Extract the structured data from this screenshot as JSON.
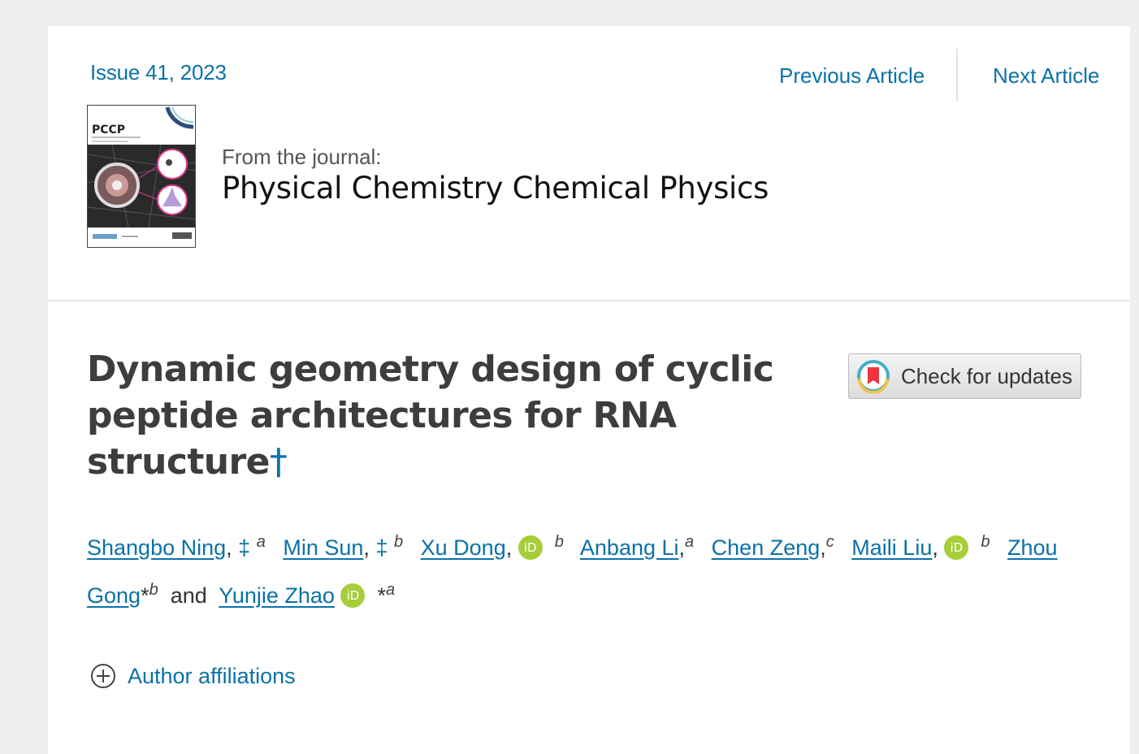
{
  "issue": "Issue 41, 2023",
  "nav": {
    "previous": "Previous Article",
    "next": "Next Article"
  },
  "journal": {
    "from_label": "From the journal:",
    "name": "Physical Chemistry Chemical Physics",
    "cover_title": "PCCP"
  },
  "article": {
    "title": "Dynamic geometry design of cyclic peptide architectures for RNA structure",
    "title_footnote": "†",
    "check_updates_label": "Check for updates"
  },
  "authors": [
    {
      "name": "Shangbo Ning",
      "marks": "‡",
      "sup": "a",
      "orcid": false
    },
    {
      "name": "Min Sun",
      "marks": "‡",
      "sup": "b",
      "orcid": false
    },
    {
      "name": "Xu Dong",
      "marks": "",
      "sup": "b",
      "orcid": true
    },
    {
      "name": "Anbang Li",
      "marks": "",
      "sup": "a",
      "orcid": false
    },
    {
      "name": "Chen Zeng",
      "marks": "",
      "sup": "c",
      "orcid": false
    },
    {
      "name": "Maili Liu",
      "marks": "",
      "sup": "b",
      "orcid": true
    },
    {
      "name": "Zhou Gong",
      "marks": "*",
      "sup": "b",
      "orcid": false
    },
    {
      "name": "Yunjie Zhao",
      "marks": "*",
      "sup": "a",
      "orcid": true
    }
  ],
  "authors_conjunction": "and",
  "orcid_label": "iD",
  "affiliations_label": "Author affiliations",
  "colors": {
    "link": "#0a72a8",
    "orcid": "#a6ce39",
    "background": "#efeff0"
  }
}
